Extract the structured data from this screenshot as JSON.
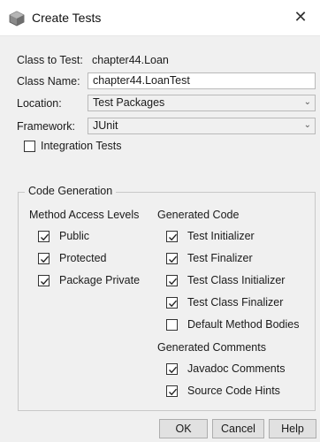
{
  "window": {
    "title": "Create Tests",
    "icon": "cube-icon",
    "close_glyph": "✕"
  },
  "form": {
    "class_to_test_label": "Class to Test:",
    "class_to_test_value": "chapter44.Loan",
    "class_name_label": "Class Name:",
    "class_name_value": "chapter44.LoanTest",
    "location_label": "Location:",
    "location_value": "Test Packages",
    "framework_label": "Framework:",
    "framework_value": "JUnit",
    "integration_tests_label": "Integration Tests",
    "integration_tests_checked": false
  },
  "code_generation": {
    "title": "Code Generation",
    "method_access": {
      "heading": "Method Access Levels",
      "items": [
        {
          "label": "Public",
          "checked": true
        },
        {
          "label": "Protected",
          "checked": true
        },
        {
          "label": "Package Private",
          "checked": true
        }
      ]
    },
    "generated_code": {
      "heading": "Generated Code",
      "items": [
        {
          "label": "Test Initializer",
          "checked": true
        },
        {
          "label": "Test Finalizer",
          "checked": true
        },
        {
          "label": "Test Class Initializer",
          "checked": true
        },
        {
          "label": "Test Class Finalizer",
          "checked": true
        },
        {
          "label": "Default Method Bodies",
          "checked": false
        }
      ]
    },
    "generated_comments": {
      "heading": "Generated Comments",
      "items": [
        {
          "label": "Javadoc Comments",
          "checked": true
        },
        {
          "label": "Source Code Hints",
          "checked": true
        }
      ]
    }
  },
  "buttons": {
    "ok": "OK",
    "cancel": "Cancel",
    "help": "Help"
  }
}
